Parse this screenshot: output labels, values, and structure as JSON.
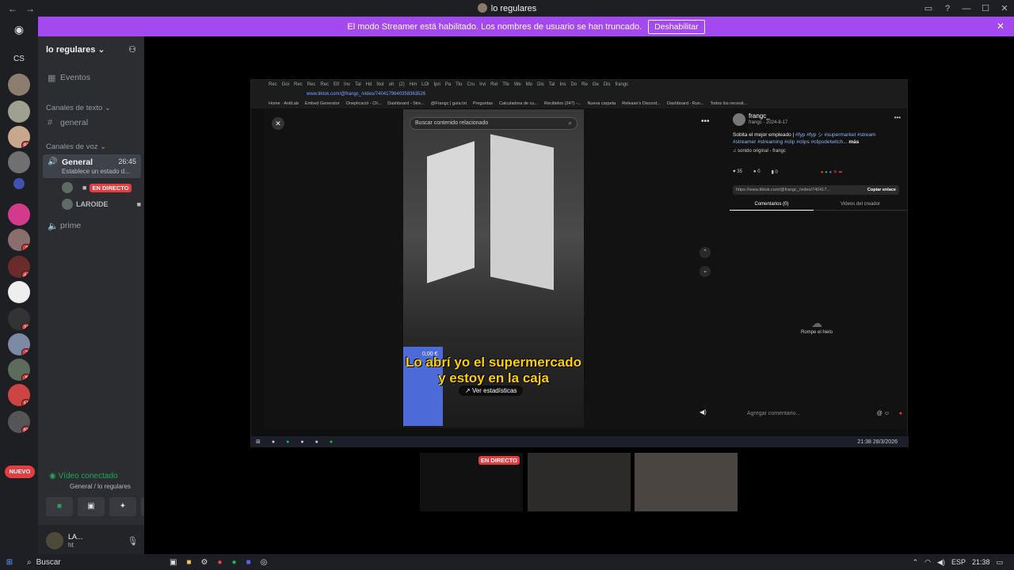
{
  "titlebar": {
    "title": "lo regulares",
    "back": "←",
    "forward": "→"
  },
  "banner": {
    "text": "El modo Streamer está habilitado. Los nombres de usuario se han truncado.",
    "button": "Deshabilitar"
  },
  "rail": {
    "home_label": "CS",
    "badges": [
      "97",
      "2",
      "44",
      "22",
      "2",
      "5",
      "13",
      "59"
    ],
    "new_label": "NUEVO"
  },
  "server": {
    "name": "lo regulares"
  },
  "sidebar": {
    "events": "Eventos",
    "text_category": "Canales de texto",
    "text_channel": "general",
    "voice_category": "Canales de voz",
    "voice_channel": {
      "name": "General",
      "time": "26:45",
      "status": "Establece un estado d..."
    },
    "voice_users": [
      {
        "name": "",
        "live": "EN DIRECTO"
      },
      {
        "name": "LAROIDE",
        "live": ""
      }
    ],
    "other_channel": "prime"
  },
  "voice_panel": {
    "status": "Vídeo conectado",
    "location": "General / lo regulares"
  },
  "user": {
    "name": "LA...",
    "sub": "ht"
  },
  "stream": {
    "browser_url": "www.tiktok.com/@frangc_/video/7404179640358363526",
    "tabs": [
      "Rec",
      "Goi",
      "Rec",
      "Rec",
      "Rec",
      "Elf",
      "Inv",
      "Tal",
      "Hd",
      "Not",
      "oh",
      "(2)",
      "Hm",
      "LOl",
      "Ipri",
      "Pa",
      "Tlo",
      "Cru",
      "Irvi",
      "Rel",
      "Tfe",
      "We",
      "Mo",
      "Dis",
      "Tal",
      "Ins",
      "Do",
      "Re",
      "Ge",
      "Dis",
      "frangc"
    ],
    "bookmarks": [
      "Home · AnitLab",
      "Embed Generator",
      "Oneplicació - Cli...",
      "Dashboard - Stre...",
      "@Frangc | guía.txt",
      "Preguntas",
      "Calculadora de cu...",
      "Recibidos (247) -...",
      "Nueva carpeta",
      "Release's Discord...",
      "Dashboard - Run...",
      "Todos los necesit..."
    ],
    "search_placeholder": "Buscar contenido relacionado",
    "caption": "Lo abrí yo el supermercado y estoy en la caja",
    "stats_button": "Ver estadísticas",
    "price_tag": "0,00 €",
    "author": "frangc_",
    "author_meta": "frangc · 2024-8-17",
    "description": "Sobita el mejor empleado |",
    "tags": "#fyp #fyp シ #supermarket #stream #streamer #streaming #clip #clips #clipsdetwitch...",
    "more": "más",
    "sound": "♫ sonido original - frangc",
    "likes": "35",
    "comments_count": "0",
    "saves": "0",
    "link": "https://www.tiktok.com/@frangc_/video/740417...",
    "copy_link": "Copiar enlace",
    "tab_comments": "Comentarios (0)",
    "tab_creator": "Videos del creador",
    "empty": "Rompe el hielo",
    "comment_placeholder": "Agregar comentario...",
    "tray_time": "21:38",
    "tray_date": "28/3/2026"
  },
  "thumbs": {
    "live": "EN DIRECTO"
  },
  "taskbar": {
    "search": "Buscar",
    "lang": "ESP",
    "time": "21:38"
  }
}
